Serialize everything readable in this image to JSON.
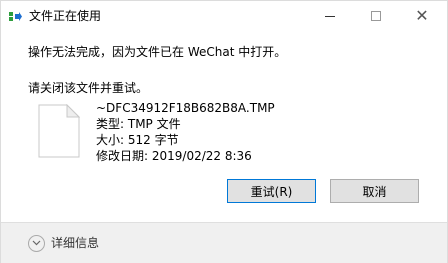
{
  "window": {
    "title": "文件正在使用",
    "min_label": "",
    "close_glyph": "✕"
  },
  "message": {
    "main": "操作无法完成，因为文件已在 WeChat 中打开。",
    "instruction": "请关闭该文件并重试。"
  },
  "file": {
    "name": "~DFC34912F18B682B8A.TMP",
    "type_line": "类型: TMP 文件",
    "size_line": "大小: 512 字节",
    "modified_line": "修改日期: 2019/02/22 8:36"
  },
  "buttons": {
    "retry_label": "重试(R)",
    "cancel_label": "取消"
  },
  "footer": {
    "details_label": "详细信息"
  },
  "colors": {
    "icon_green": "#2e9e3e",
    "icon_blue": "#1e6fd0",
    "accent_border": "#0078d7",
    "footer_bg": "#f0f0f0"
  },
  "icons": {
    "app": "file-in-use-icon",
    "file": "blank-file-icon",
    "details": "chevron-down-icon"
  }
}
